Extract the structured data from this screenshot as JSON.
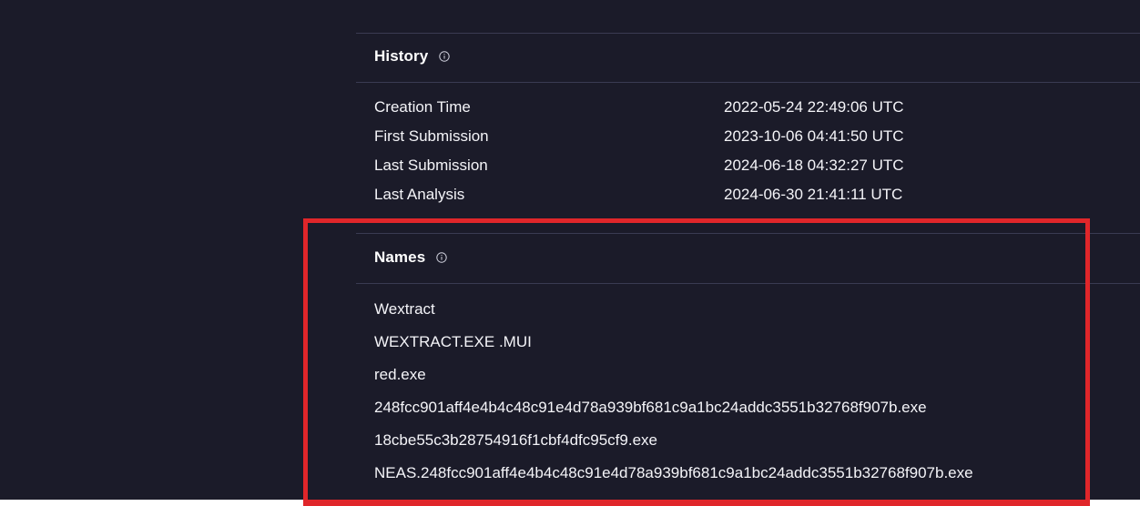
{
  "history": {
    "title": "History",
    "info_icon": "info-circle-icon",
    "rows": [
      {
        "label": "Creation Time",
        "value": "2022-05-24 22:49:06 UTC"
      },
      {
        "label": "First Submission",
        "value": "2023-10-06 04:41:50 UTC"
      },
      {
        "label": "Last Submission",
        "value": "2024-06-18 04:32:27 UTC"
      },
      {
        "label": "Last Analysis",
        "value": "2024-06-30 21:41:11 UTC"
      }
    ]
  },
  "names": {
    "title": "Names",
    "info_icon": "info-circle-icon",
    "items": [
      "Wextract",
      "WEXTRACT.EXE .MUI",
      "red.exe",
      "248fcc901aff4e4b4c48c91e4d78a939bf681c9a1bc24addc3551b32768f907b.exe",
      "18cbe55c3b28754916f1cbf4dfc95cf9.exe",
      "NEAS.248fcc901aff4e4b4c48c91e4d78a939bf681c9a1bc24addc3551b32768f907b.exe"
    ]
  },
  "colors": {
    "background": "#1b1b29",
    "divider": "#3a3b52",
    "highlight": "#e0262a",
    "text": "#f4f4f8"
  }
}
